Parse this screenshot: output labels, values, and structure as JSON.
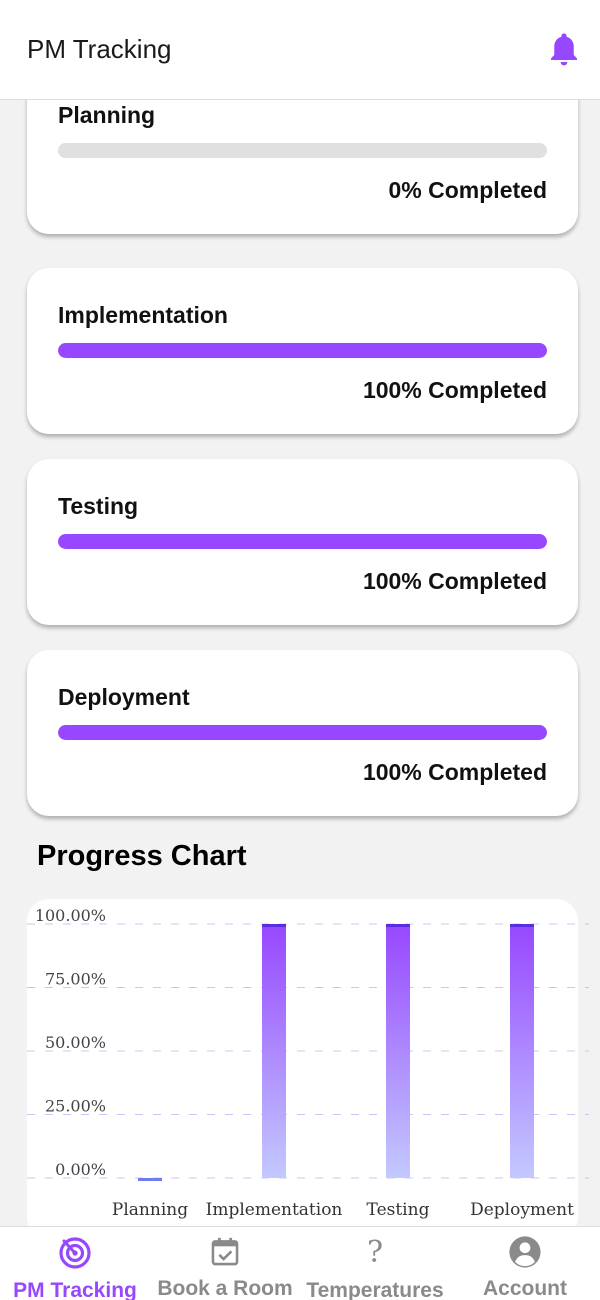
{
  "header": {
    "title": "PM Tracking",
    "bell_icon": "bell-icon"
  },
  "colors": {
    "accent": "#9747ff",
    "track": "#e0e0e0",
    "inactive": "#8a8a8a"
  },
  "phases": [
    {
      "name": "Planning",
      "progress": 0,
      "status": "0% Completed"
    },
    {
      "name": "Implementation",
      "progress": 100,
      "status": "100% Completed"
    },
    {
      "name": "Testing",
      "progress": 100,
      "status": "100% Completed"
    },
    {
      "name": "Deployment",
      "progress": 100,
      "status": "100% Completed"
    }
  ],
  "chart": {
    "heading": "Progress Chart"
  },
  "chart_data": {
    "type": "bar",
    "categories": [
      "Planning",
      "Implementation",
      "Testing",
      "Deployment"
    ],
    "values": [
      0,
      100,
      100,
      100
    ],
    "ylim": [
      0,
      100
    ],
    "yticks": [
      "0.00%",
      "25.00%",
      "50.00%",
      "75.00%",
      "100.00%"
    ],
    "grid": true
  },
  "tabs": [
    {
      "label": "PM Tracking",
      "icon": "radar-icon",
      "active": true
    },
    {
      "label": "Book a Room",
      "icon": "calendar-check-icon",
      "active": false
    },
    {
      "label": "Temperatures",
      "icon": "question-icon",
      "active": false
    },
    {
      "label": "Account",
      "icon": "account-icon",
      "active": false
    }
  ]
}
